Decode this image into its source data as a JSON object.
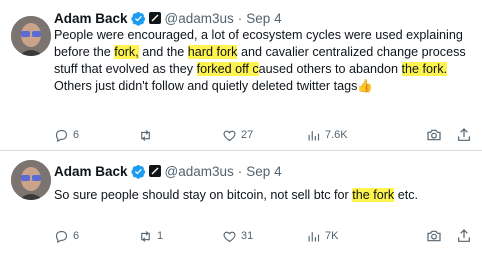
{
  "tweets": [
    {
      "author": {
        "name": "Adam Back",
        "handle": "@adam3us",
        "separator": "·",
        "date": "Sep 4"
      },
      "text_segments": [
        {
          "t": "People were encouraged, a lot of ecosystem cycles were used explaining before the "
        },
        {
          "t": "fork,",
          "hl": true
        },
        {
          "t": " and the "
        },
        {
          "t": "hard fork",
          "hl": true
        },
        {
          "t": " and cavalier centralized change process stuff that evolved as they "
        },
        {
          "t": "forked off c",
          "hl": true
        },
        {
          "t": "aused others to abandon "
        },
        {
          "t": "the fork.",
          "hl": true
        },
        {
          "t": " Others just didn't follow and quietly deleted twitter tags👍"
        }
      ],
      "stats": {
        "replies": "6",
        "retweets": "",
        "likes": "27",
        "views": "7.6K"
      }
    },
    {
      "author": {
        "name": "Adam Back",
        "handle": "@adam3us",
        "separator": "·",
        "date": "Sep 4"
      },
      "text_segments": [
        {
          "t": "So sure people should stay on bitcoin, not sell btc for "
        },
        {
          "t": "the fork",
          "hl": true
        },
        {
          "t": " etc."
        }
      ],
      "stats": {
        "replies": "6",
        "retweets": "1",
        "likes": "31",
        "views": "7K"
      }
    }
  ],
  "colors": {
    "highlight": "#fff44f",
    "verified": "#1d9bf0",
    "muted": "#536471"
  }
}
